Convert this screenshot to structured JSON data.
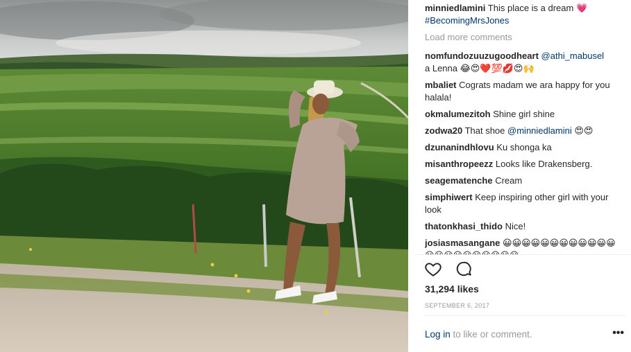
{
  "caption": {
    "user": "minniedlamini",
    "text": "This place is a dream 💗",
    "hashtag": "#BecomingMrsJones"
  },
  "load_more": "Load more comments",
  "comments": [
    {
      "user": "nomfundozuuzugoodheart",
      "mention": "@athi_mabusel",
      "text": "a Lenna 😂😍❤️💯💋😍🙌"
    },
    {
      "user": "mbaliet",
      "text": "Cograts madam we ara happy for you halala!"
    },
    {
      "user": "okmalumezitoh",
      "text": "Shine girl shine"
    },
    {
      "user": "zodwa20",
      "text": "That shoe",
      "mention": "@minniedlamini",
      "text2": "😍😍"
    },
    {
      "user": "dzunanindhlovu",
      "text": "Ku shonga ka"
    },
    {
      "user": "misanthropeezz",
      "text": "Looks like Drakensberg."
    },
    {
      "user": "seagematenche",
      "text": "Cream"
    },
    {
      "user": "simphiwert",
      "text": "Keep inspiring other girl with your look"
    },
    {
      "user": "thatonkhasi_thido",
      "text": "Nice!"
    },
    {
      "user": "josiasmasangane",
      "text": "😀😀😀😀😀😀😀😀😀😀😀😀😀😀😀😀😀😀😀😀😀😀"
    }
  ],
  "actions": {
    "like": "heart-icon",
    "comment": "comment-icon"
  },
  "likes": "31,294 likes",
  "date": "SEPTEMBER 6, 2017",
  "login": {
    "link": "Log in",
    "rest": " to like or comment."
  },
  "more": "•••",
  "colors": {
    "link": "#003569",
    "muted": "#999999",
    "text": "#262626"
  }
}
